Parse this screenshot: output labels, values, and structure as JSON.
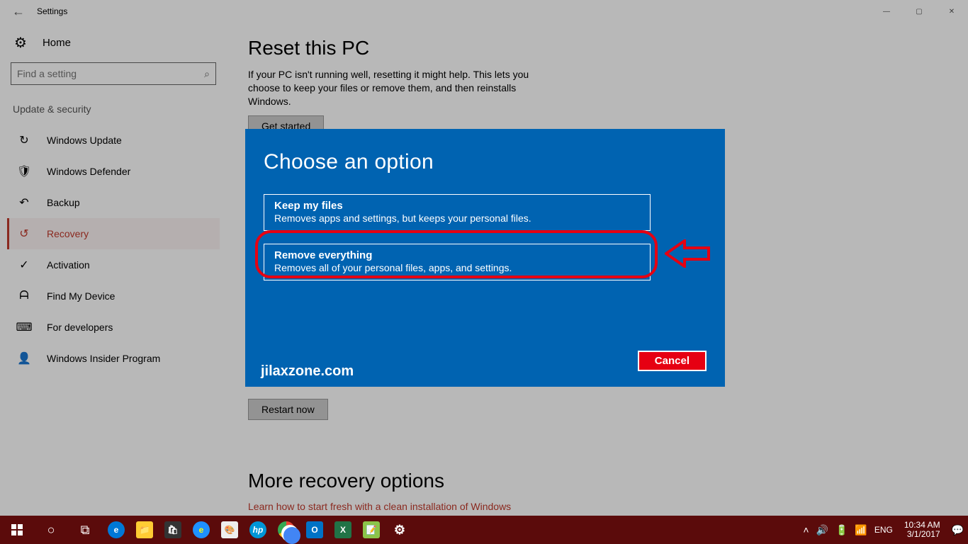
{
  "titlebar": {
    "title": "Settings"
  },
  "sidebar": {
    "home": "Home",
    "search_placeholder": "Find a setting",
    "category": "Update & security",
    "items": [
      {
        "label": "Windows Update"
      },
      {
        "label": "Windows Defender"
      },
      {
        "label": "Backup"
      },
      {
        "label": "Recovery"
      },
      {
        "label": "Activation"
      },
      {
        "label": "Find My Device"
      },
      {
        "label": "For developers"
      },
      {
        "label": "Windows Insider Program"
      }
    ]
  },
  "main": {
    "heading1": "Reset this PC",
    "desc1": "If your PC isn't running well, resetting it might help. This lets you choose to keep your files or remove them, and then reinstalls Windows.",
    "get_started": "Get started",
    "restart_now": "Restart now",
    "heading2": "More recovery options",
    "link": "Learn how to start fresh with a clean installation of Windows"
  },
  "dialog": {
    "title": "Choose an option",
    "opt1_title": "Keep my files",
    "opt1_desc": "Removes apps and settings, but keeps your personal files.",
    "opt2_title": "Remove everything",
    "opt2_desc": "Removes all of your personal files, apps, and settings.",
    "attribution": "jilaxzone.com",
    "cancel": "Cancel"
  },
  "taskbar": {
    "lang": "ENG",
    "time": "10:34 AM",
    "date": "3/1/2017"
  }
}
